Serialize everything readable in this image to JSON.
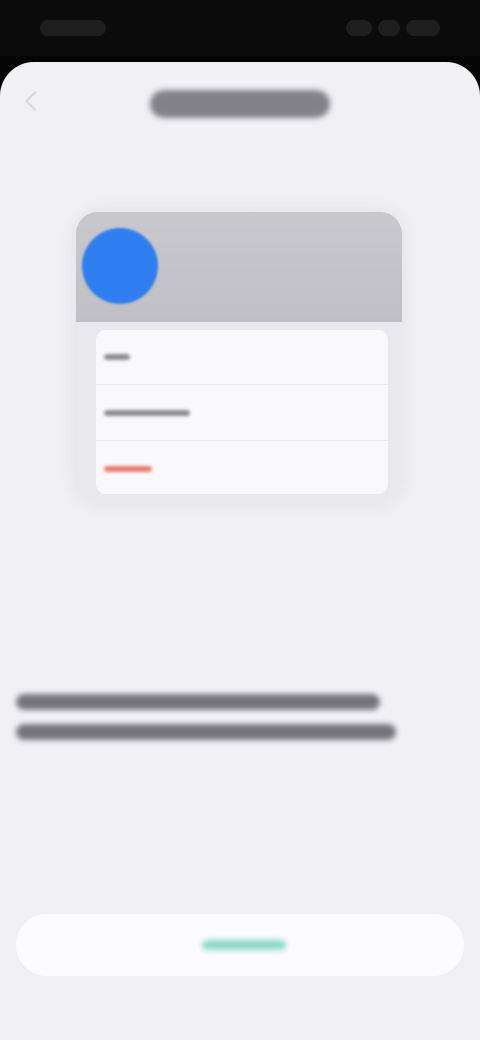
{
  "status_bar": {
    "time": "",
    "indicators": [
      "signal-icon",
      "wifi-icon",
      "battery-icon"
    ]
  },
  "sheet": {
    "title": "",
    "back_icon": "chevron-left-icon"
  },
  "illustration": {
    "avatar_color": "#2f7ef0",
    "rows": [
      {
        "label": "",
        "color": "#8d8d93"
      },
      {
        "label": "",
        "color": "#8d8d93"
      },
      {
        "label": "",
        "color": "#e9776f"
      }
    ]
  },
  "description": {
    "text": ""
  },
  "primary_button": {
    "label": "",
    "color": "#8ad8cc"
  },
  "colors": {
    "sheet_background": "#f1f1f5",
    "accent_blue": "#2f7ef0",
    "destructive_red": "#e9776f",
    "button_text_teal": "#8ad8cc"
  }
}
